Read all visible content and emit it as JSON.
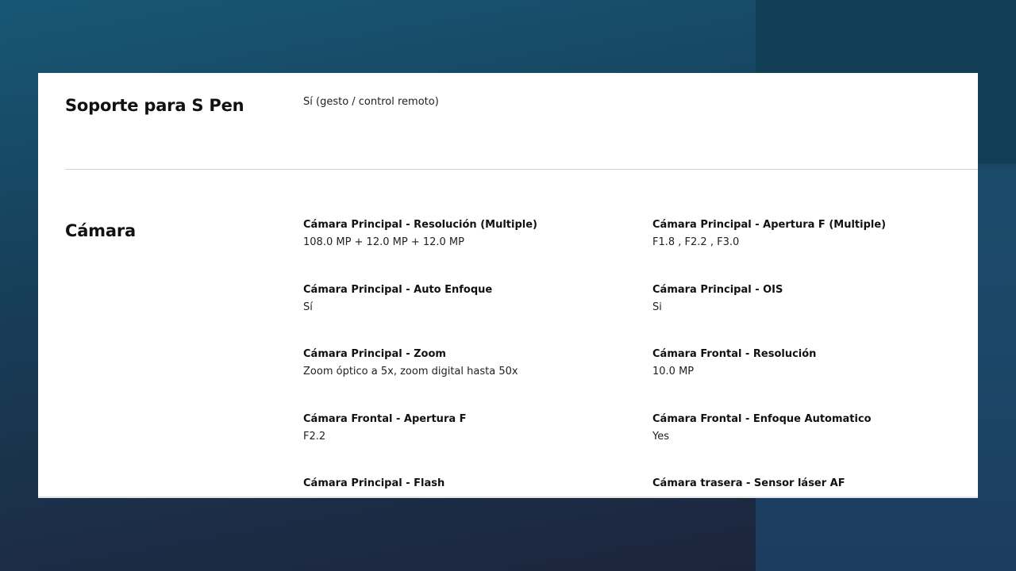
{
  "sections": {
    "spen": {
      "title": "Soporte para S Pen",
      "value": "Sí (gesto / control remoto)"
    },
    "camera": {
      "title": "Cámara",
      "specs": [
        {
          "label": "Cámara Principal - Resolución (Multiple)",
          "value": "108.0 MP + 12.0 MP + 12.0 MP"
        },
        {
          "label": "Cámara Principal - Apertura F (Multiple)",
          "value": "F1.8 , F2.2 , F3.0"
        },
        {
          "label": "Cámara Principal - Auto Enfoque",
          "value": "Sí"
        },
        {
          "label": "Cámara Principal - OIS",
          "value": "Si"
        },
        {
          "label": "Cámara Principal - Zoom",
          "value": "Zoom óptico a 5x, zoom digital hasta 50x"
        },
        {
          "label": "Cámara Frontal - Resolución",
          "value": "10.0 MP"
        },
        {
          "label": "Cámara Frontal - Apertura F",
          "value": "F2.2"
        },
        {
          "label": "Cámara Frontal - Enfoque Automatico",
          "value": "Yes"
        },
        {
          "label": "Cámara Principal - Flash",
          "value": ""
        },
        {
          "label": "Cámara trasera - Sensor láser AF",
          "value": ""
        }
      ]
    }
  }
}
